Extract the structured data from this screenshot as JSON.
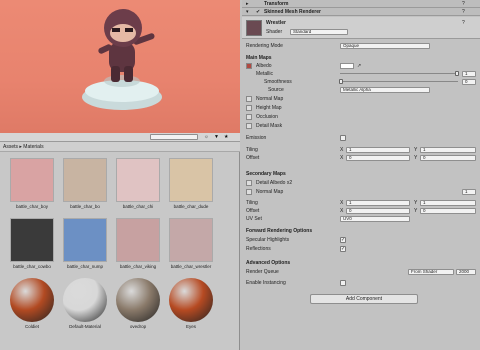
{
  "scene": {
    "name": "scene-view"
  },
  "assets": {
    "breadcrumb": "Assets ▸ Materials",
    "search_placeholder": "",
    "items": [
      {
        "label": "battle_char_boy",
        "color": "#d9a3a3"
      },
      {
        "label": "battle_char_bo",
        "color": "#c8b4a2"
      },
      {
        "label": "battle_char_chi",
        "color": "#e0c3c3"
      },
      {
        "label": "battle_char_dude",
        "color": "#d9c4a6"
      },
      {
        "label": "battle_char_cowbo",
        "color": "#3a3a3a"
      },
      {
        "label": "battle_char_nump",
        "color": "#6c90c4"
      },
      {
        "label": "battle_char_viking",
        "color": "#c7a1a1"
      },
      {
        "label": "battle_char_wrestler",
        "color": "#c4a8a8"
      },
      {
        "label": "Coldiet",
        "color": "#b24a22"
      },
      {
        "label": "Default-Material",
        "color": "#d8d8d8"
      },
      {
        "label": "ovedrop",
        "color": "#8a7a6a"
      },
      {
        "label": "Eyes",
        "color": "#b64a22"
      }
    ]
  },
  "inspector": {
    "transform": "Transform",
    "skinned_mesh": "Skinned Mesh Renderer",
    "material_name": "Wrestler",
    "shader_label": "Shader",
    "shader_value": "Standard",
    "rendering_mode_label": "Rendering Mode",
    "rendering_mode_value": "Opaque",
    "main_maps": "Main Maps",
    "albedo": "Albedo",
    "metallic": "Metallic",
    "metallic_value": "1",
    "smoothness": "Smoothness",
    "smoothness_value": "0",
    "source": "Source",
    "source_value": "Metallic Alpha",
    "normal_map": "Normal Map",
    "height_map": "Height Map",
    "occlusion": "Occlusion",
    "detail_mask": "Detail Mask",
    "emission": "Emission",
    "tiling": "Tiling",
    "offset": "Offset",
    "tiling_x": "1",
    "tiling_y": "1",
    "offset_x": "0",
    "offset_y": "0",
    "secondary_maps": "Secondary Maps",
    "detail_albedo": "Detail Albedo x2",
    "normal_map2": "Normal Map",
    "normal_map2_value": "1",
    "tiling2_x": "1",
    "tiling2_y": "1",
    "offset2_x": "0",
    "offset2_y": "0",
    "uv_set": "UV Set",
    "uv_set_value": "UV0",
    "forward_options": "Forward Rendering Options",
    "specular": "Specular Highlights",
    "reflections": "Reflections",
    "advanced": "Advanced Options",
    "render_queue": "Render Queue",
    "render_queue_mode": "From Shader",
    "render_queue_value": "2000",
    "instancing": "Enable Instancing",
    "add_component": "Add Component",
    "x": "X",
    "y": "Y"
  }
}
